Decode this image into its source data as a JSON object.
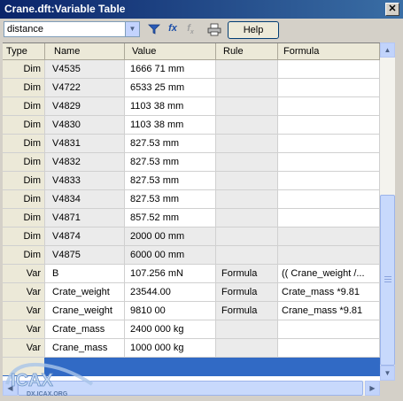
{
  "window": {
    "title": "Crane.dft:Variable Table",
    "close_glyph": "✕"
  },
  "toolbar": {
    "filter_value": "distance",
    "help_label": "Help"
  },
  "icons": {
    "filter": "funnel-icon",
    "formula": "fx-icon",
    "formula_disabled": "fx-sub-icon",
    "print": "printer-icon",
    "dropdown": "chevron-down-icon"
  },
  "columns": [
    "Type",
    "Name",
    "Value",
    "Rule",
    "Formula"
  ],
  "rows": [
    {
      "type": "Dim",
      "name": "V4535",
      "value": "1666 71 mm",
      "rule": "",
      "formula": ""
    },
    {
      "type": "Dim",
      "name": "V4722",
      "value": "6533 25 mm",
      "rule": "",
      "formula": ""
    },
    {
      "type": "Dim",
      "name": "V4829",
      "value": "1103 38 mm",
      "rule": "",
      "formula": ""
    },
    {
      "type": "Dim",
      "name": "V4830",
      "value": "1103 38 mm",
      "rule": "",
      "formula": ""
    },
    {
      "type": "Dim",
      "name": "V4831",
      "value": "827.53 mm",
      "rule": "",
      "formula": ""
    },
    {
      "type": "Dim",
      "name": "V4832",
      "value": "827.53 mm",
      "rule": "",
      "formula": ""
    },
    {
      "type": "Dim",
      "name": "V4833",
      "value": "827.53 mm",
      "rule": "",
      "formula": ""
    },
    {
      "type": "Dim",
      "name": "V4834",
      "value": "827.53 mm",
      "rule": "",
      "formula": ""
    },
    {
      "type": "Dim",
      "name": "V4871",
      "value": "857.52 mm",
      "rule": "",
      "formula": ""
    },
    {
      "type": "Dim",
      "name": "V4874",
      "value": "2000 00 mm",
      "rule": "",
      "formula": ""
    },
    {
      "type": "Dim",
      "name": "V4875",
      "value": "6000 00 mm",
      "rule": "",
      "formula": ""
    },
    {
      "type": "Var",
      "name": "B",
      "value": "107.256 mN",
      "rule": "Formula",
      "formula": "(( Crane_weight /..."
    },
    {
      "type": "Var",
      "name": "Crate_weight",
      "value": "23544.00",
      "rule": "Formula",
      "formula": "Crate_mass *9.81"
    },
    {
      "type": "Var",
      "name": "Crane_weight",
      "value": "9810 00",
      "rule": "Formula",
      "formula": "Crane_mass *9.81"
    },
    {
      "type": "Var",
      "name": "Crate_mass",
      "value": "2400 000 kg",
      "rule": "",
      "formula": ""
    },
    {
      "type": "Var",
      "name": "Crane_mass",
      "value": "1000 000 kg",
      "rule": "",
      "formula": ""
    },
    {
      "type": "",
      "name": "",
      "value": "",
      "rule": "",
      "formula": ""
    }
  ],
  "selected_row": 16,
  "watermark": {
    "text": "DX.ICAX.ORG",
    "logo": "icax-logo"
  },
  "colors": {
    "title_bar": "#0a246a",
    "selection": "#316ac5",
    "header_bg": "#ece9d8",
    "readonly_cell": "#ebebeb"
  }
}
